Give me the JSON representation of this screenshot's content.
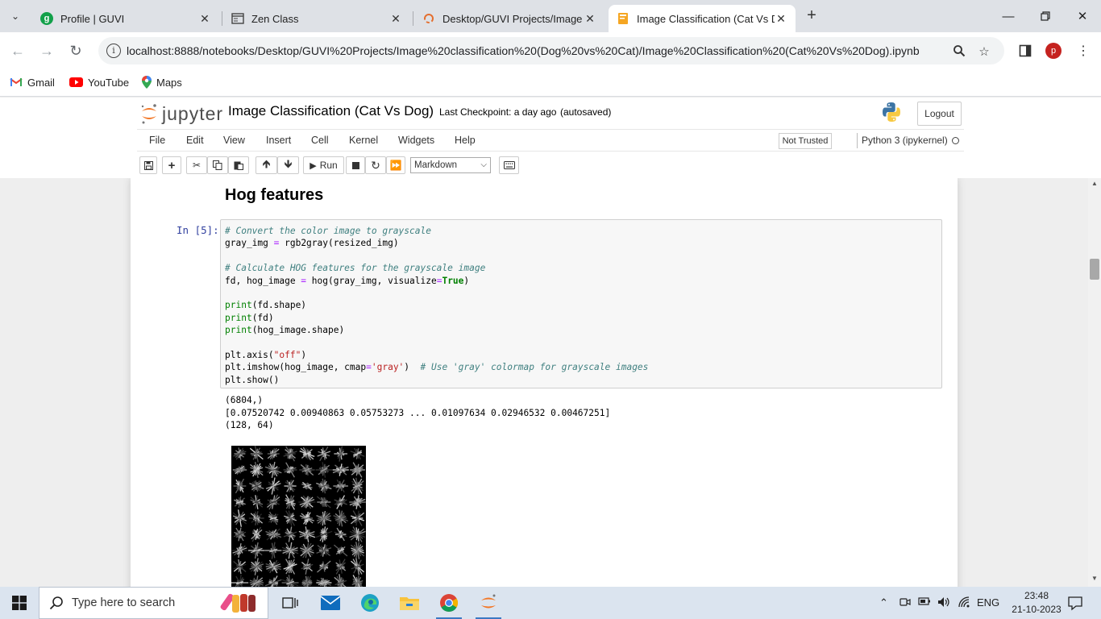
{
  "browser": {
    "tabs": [
      {
        "label": "Profile | GUVI",
        "icon": "guvi-icon"
      },
      {
        "label": "Zen Class",
        "icon": "window-icon"
      },
      {
        "label": "Desktop/GUVI Projects/Image",
        "icon": "jupyter-loading-icon"
      },
      {
        "label": "Image Classification (Cat Vs Do",
        "icon": "notebook-icon"
      }
    ],
    "url": "localhost:8888/notebooks/Desktop/GUVI%20Projects/Image%20classification%20(Dog%20vs%20Cat)/Image%20Classification%20(Cat%20Vs%20Dog).ipynb",
    "profile_initial": "p",
    "bookmarks": [
      {
        "label": "Gmail",
        "icon": "gmail-icon"
      },
      {
        "label": "YouTube",
        "icon": "youtube-icon"
      },
      {
        "label": "Maps",
        "icon": "maps-icon"
      }
    ]
  },
  "jupyter": {
    "logo_text": "jupyter",
    "notebook_name": "Image Classification (Cat Vs Dog)",
    "checkpoint": "Last Checkpoint: a day ago",
    "autosave": "(autosaved)",
    "logout_label": "Logout",
    "menus": [
      "File",
      "Edit",
      "View",
      "Insert",
      "Cell",
      "Kernel",
      "Widgets",
      "Help"
    ],
    "trust_label": "Not Trusted",
    "kernel_label": "Python 3 (ipykernel)",
    "run_label": "Run",
    "cell_type": "Markdown"
  },
  "notebook": {
    "heading": "Hog features",
    "prompt": "In [5]:",
    "code_lines": [
      [
        {
          "t": "# Convert the color image to grayscale",
          "c": "cm-comment"
        }
      ],
      [
        {
          "t": "gray_img "
        },
        {
          "t": "=",
          "c": "cm-op"
        },
        {
          "t": " rgb2gray(resized_img)"
        }
      ],
      [],
      [
        {
          "t": "# Calculate HOG features for the grayscale image",
          "c": "cm-comment"
        }
      ],
      [
        {
          "t": "fd, hog_image "
        },
        {
          "t": "=",
          "c": "cm-op"
        },
        {
          "t": " hog(gray_img, visualize"
        },
        {
          "t": "=",
          "c": "cm-op"
        },
        {
          "t": "True",
          "c": "cm-keyword"
        },
        {
          "t": ")"
        }
      ],
      [],
      [
        {
          "t": "print",
          "c": "cm-builtin"
        },
        {
          "t": "(fd.shape)"
        }
      ],
      [
        {
          "t": "print",
          "c": "cm-builtin"
        },
        {
          "t": "(fd)"
        }
      ],
      [
        {
          "t": "print",
          "c": "cm-builtin"
        },
        {
          "t": "(hog_image.shape)"
        }
      ],
      [],
      [
        {
          "t": "plt.axis("
        },
        {
          "t": "\"off\"",
          "c": "cm-string"
        },
        {
          "t": ")"
        }
      ],
      [
        {
          "t": "plt.imshow(hog_image, cmap"
        },
        {
          "t": "=",
          "c": "cm-op"
        },
        {
          "t": "'gray'",
          "c": "cm-string"
        },
        {
          "t": ")  "
        },
        {
          "t": "# Use 'gray' colormap for grayscale images",
          "c": "cm-comment"
        }
      ],
      [
        {
          "t": "plt.show()"
        }
      ]
    ],
    "output_lines": [
      "(6804,)",
      "[0.07520742 0.00940863 0.05753273 ... 0.01097634 0.02946532 0.00467251]",
      "(128, 64)"
    ]
  },
  "taskbar": {
    "search_placeholder": "Type here to search",
    "language": "ENG",
    "time": "23:48",
    "date": "21-10-2023"
  }
}
